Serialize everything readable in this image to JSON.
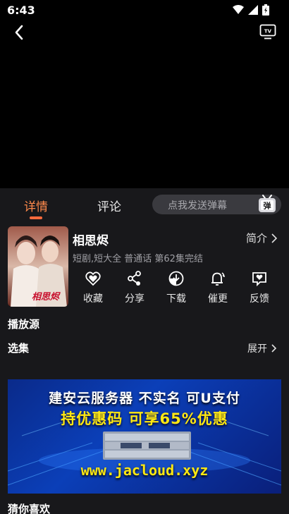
{
  "status": {
    "time": "6:43"
  },
  "tabs": [
    {
      "label": "详情",
      "active": true
    },
    {
      "label": "评论",
      "active": false
    }
  ],
  "danmu": {
    "placeholder": "点我发送弹幕",
    "icon_label": "弹"
  },
  "show": {
    "title": "相思烬",
    "intro_label": "简介",
    "meta": "短剧,短大全 普通话 第62集完结",
    "poster_text": "相思烬"
  },
  "actions": [
    {
      "label": "收藏",
      "icon": "heart-icon"
    },
    {
      "label": "分享",
      "icon": "share-icon"
    },
    {
      "label": "下载",
      "icon": "download-icon"
    },
    {
      "label": "催更",
      "icon": "bell-icon"
    },
    {
      "label": "反馈",
      "icon": "feedback-icon"
    }
  ],
  "sections": {
    "source": "播放源",
    "episodes": "选集",
    "expand": "展开",
    "recommend": "猜你喜欢"
  },
  "ad": {
    "line1": "建安云服务器 不实名 可U支付",
    "line2": "持优惠码   可享65%优惠",
    "url": "www.jacloud.xyz"
  },
  "colors": {
    "accent": "#ff6a3c",
    "background": "#18181b",
    "ad_yellow": "#ffe812"
  }
}
